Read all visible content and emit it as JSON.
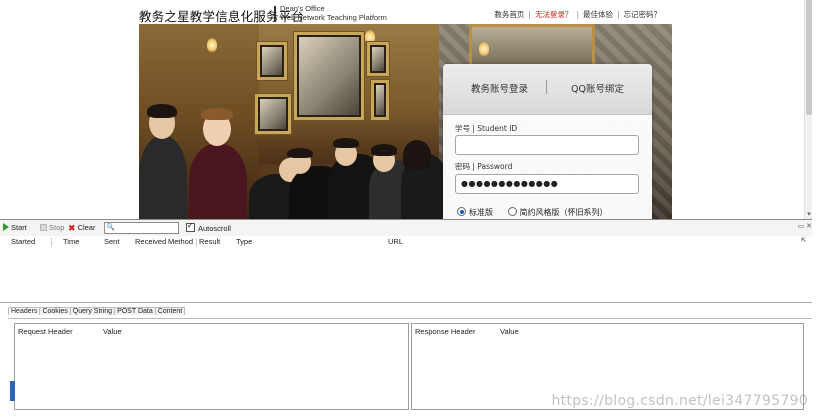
{
  "site": {
    "title": "教务之星教学信息化服务平台",
    "title_en_line1": "Dean's Office",
    "title_en_line2": "Web Network Teaching Platform"
  },
  "top_nav": {
    "items": [
      "教务首页",
      "无法登录？",
      "最佳体验",
      "忘记密码？"
    ],
    "warn_color": "#d21a1a"
  },
  "login": {
    "tab_edu": "教务账号登录",
    "tab_qq": "QQ账号绑定",
    "student_id_label": "学号 | Student ID",
    "student_id_value": "",
    "password_label": "密码 | Password",
    "password_value": "●●●●●●●●●●●●●",
    "mode_standard": "标准版",
    "mode_simple": "简约风格版（怀旧系列）",
    "selected_mode": "standard"
  },
  "devtools": {
    "toolbar": {
      "start": "Start",
      "stop": "Stop",
      "clear": "Clear",
      "search_value": "",
      "autoscroll": "Autoscroll",
      "autoscroll_checked": true
    },
    "columns": [
      "Started",
      "Time",
      "Sent",
      "Received",
      "Method",
      "Result",
      "Type",
      "URL"
    ],
    "detail_tabs": [
      "Headers",
      "Cookies",
      "Query String",
      "POST Data",
      "Content"
    ],
    "active_detail_tab": "Headers",
    "request_pane": {
      "col1": "Request Header",
      "col2": "Value"
    },
    "response_pane": {
      "col1": "Response Header",
      "col2": "Value"
    }
  },
  "watermark": "https://blog.csdn.net/lei347795790",
  "icons": {
    "start": "play-icon",
    "stop": "stop-icon",
    "clear": "clear-icon",
    "search": "search-icon"
  }
}
